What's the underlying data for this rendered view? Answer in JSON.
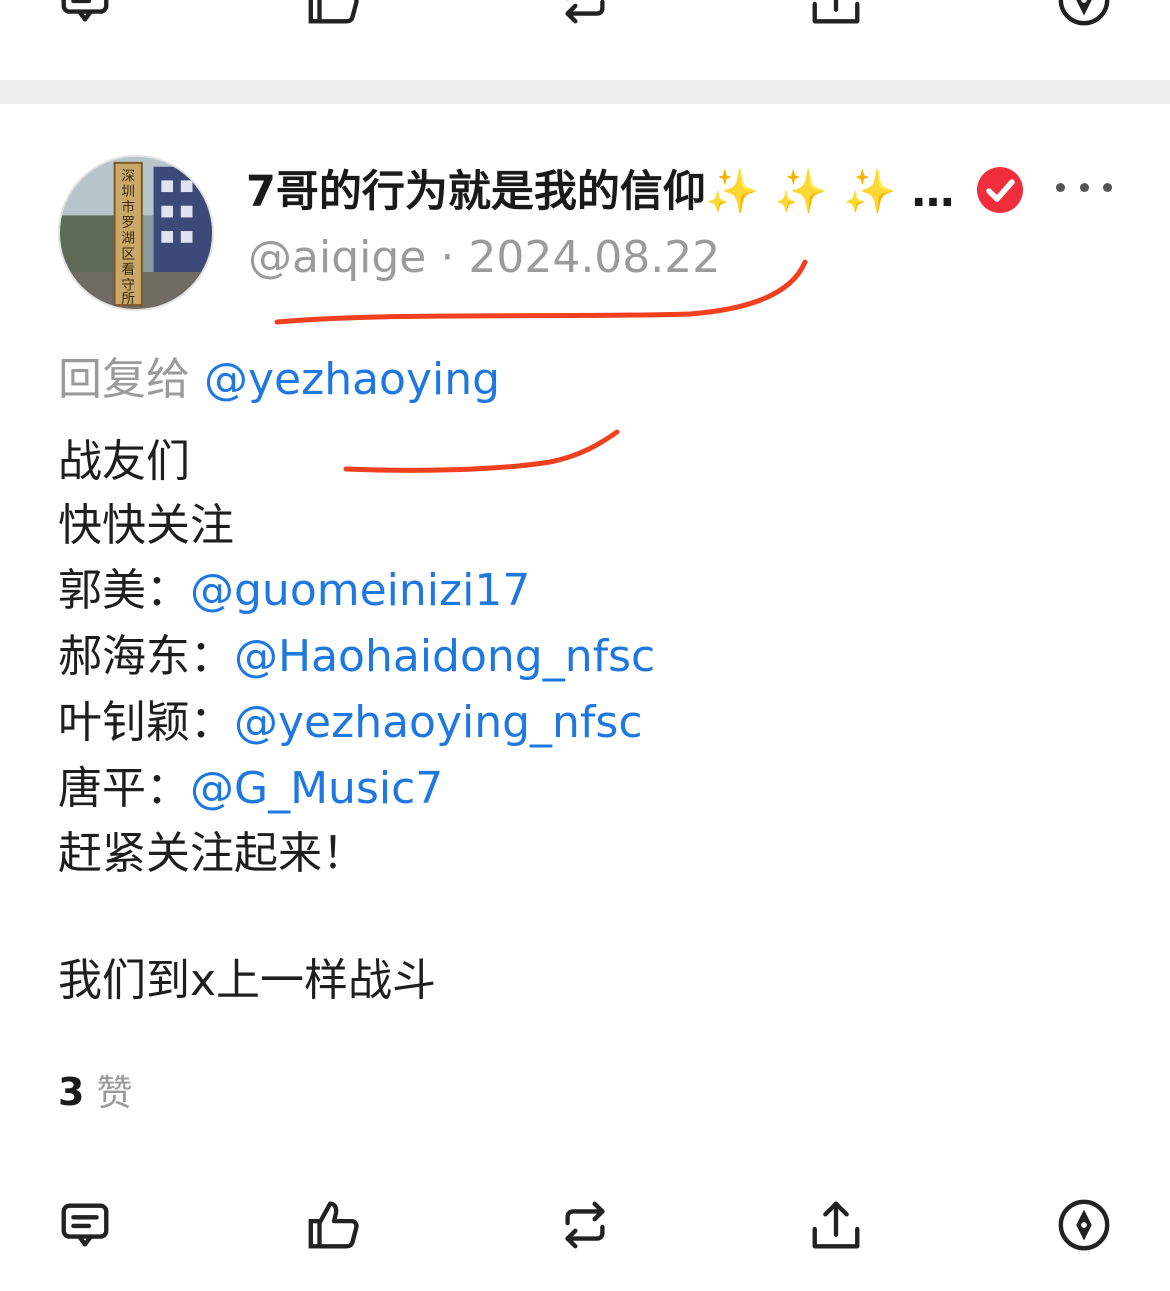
{
  "post": {
    "display_name": "7哥的行为就是我的信仰✨ ✨ ✨ …",
    "handle": "@aiqige",
    "separator": "·",
    "date": "2024.08.22",
    "reply_prefix": "回复给",
    "reply_to": "@yezhaoying",
    "line1": "战友们",
    "line2": "快快关注",
    "mentions": [
      {
        "label": "郭美：",
        "handle": "@guomeinizi17"
      },
      {
        "label": "郝海东：",
        "handle": "@Haohaidong_nfsc"
      },
      {
        "label": "叶钊颖：",
        "handle": "@yezhaoying_nfsc"
      },
      {
        "label": "唐平：",
        "handle": "@G_Music7"
      }
    ],
    "line3": "赶紧关注起来！",
    "line4": "我们到x上一样战斗",
    "likes_count": "3",
    "likes_label": "赞"
  },
  "avatar_sign_text": "深圳市罗湖区看守所",
  "icons": {
    "comment": "comment-icon",
    "like": "thumbs-up-icon",
    "repost": "repost-icon",
    "share": "share-icon",
    "extra": "compass-icon",
    "verified": "verified-check-icon",
    "more": "more-dots-icon"
  },
  "colors": {
    "link": "#1f78e0",
    "verified": "#ef2d3b",
    "annotation": "#f0401f",
    "meta": "#9b9b9b"
  }
}
